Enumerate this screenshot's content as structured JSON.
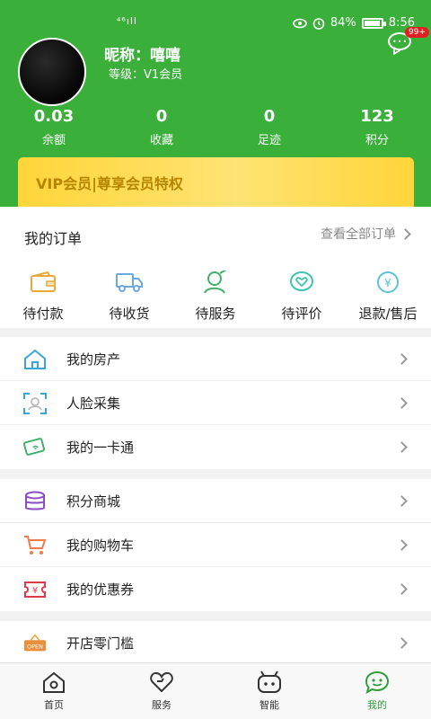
{
  "status_bar": {
    "signal": "⁴⁶ıll",
    "battery": "84%",
    "time": "8:56"
  },
  "header": {
    "badge": "99+",
    "nickname": "昵称：嘻嘻",
    "level": "等级：V1会员",
    "stats": [
      {
        "value": "0.03",
        "label": "余额"
      },
      {
        "value": "0",
        "label": "收藏"
      },
      {
        "value": "0",
        "label": "足迹"
      },
      {
        "value": "123",
        "label": "积分"
      }
    ],
    "vip_banner": "VIP会员|尊享会员特权"
  },
  "orders": {
    "title": "我的订单",
    "view_all": "查看全部订单",
    "items": [
      {
        "label": "待付款",
        "icon": "wallet-icon"
      },
      {
        "label": "待收货",
        "icon": "truck-icon"
      },
      {
        "label": "待服务",
        "icon": "service-icon"
      },
      {
        "label": "待评价",
        "icon": "review-icon"
      },
      {
        "label": "退款/售后",
        "icon": "refund-icon"
      }
    ]
  },
  "menu_group1": [
    {
      "label": "我的房产",
      "icon": "house-icon"
    },
    {
      "label": "人脸采集",
      "icon": "face-scan-icon"
    },
    {
      "label": "我的一卡通",
      "icon": "card-icon"
    }
  ],
  "menu_group2": [
    {
      "label": "积分商城",
      "icon": "coins-icon"
    },
    {
      "label": "我的购物车",
      "icon": "cart-icon"
    },
    {
      "label": "我的优惠券",
      "icon": "coupon-icon"
    }
  ],
  "menu_group3": [
    {
      "label": "开店零门槛",
      "icon": "open-sign-icon"
    }
  ],
  "tabbar": [
    {
      "label": "首页",
      "icon": "home-icon"
    },
    {
      "label": "服务",
      "icon": "heart-icon"
    },
    {
      "label": "智能",
      "icon": "robot-icon"
    },
    {
      "label": "我的",
      "icon": "profile-icon"
    }
  ],
  "colors": {
    "brand_green": "#3ab03a",
    "vip_gold": "#ffd53a",
    "active_tab": "#2f9e3a"
  }
}
